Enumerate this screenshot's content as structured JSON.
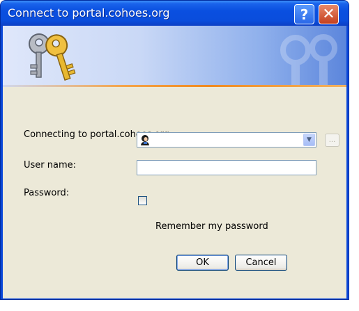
{
  "window": {
    "title": "Connect to portal.cohoes.org",
    "help_label": "?",
    "close_label": "✕"
  },
  "dialog": {
    "connecting_text": "Connecting to portal.cohoes.org.",
    "username_label": "User name:",
    "username_value": "",
    "password_label": "Password:",
    "password_value": "",
    "remember_label": "Remember my password",
    "remember_checked": false,
    "browse_label": "...",
    "combo_arrow": "▼",
    "ok_label": "OK",
    "cancel_label": "Cancel"
  },
  "colors": {
    "titlebar": "#0a4fe0",
    "client_bg": "#ece9d8",
    "accent_line": "#f08a20"
  },
  "icons": {
    "banner": "keys-icon",
    "user": "user-icon",
    "dropdown": "chevron-down-icon"
  }
}
